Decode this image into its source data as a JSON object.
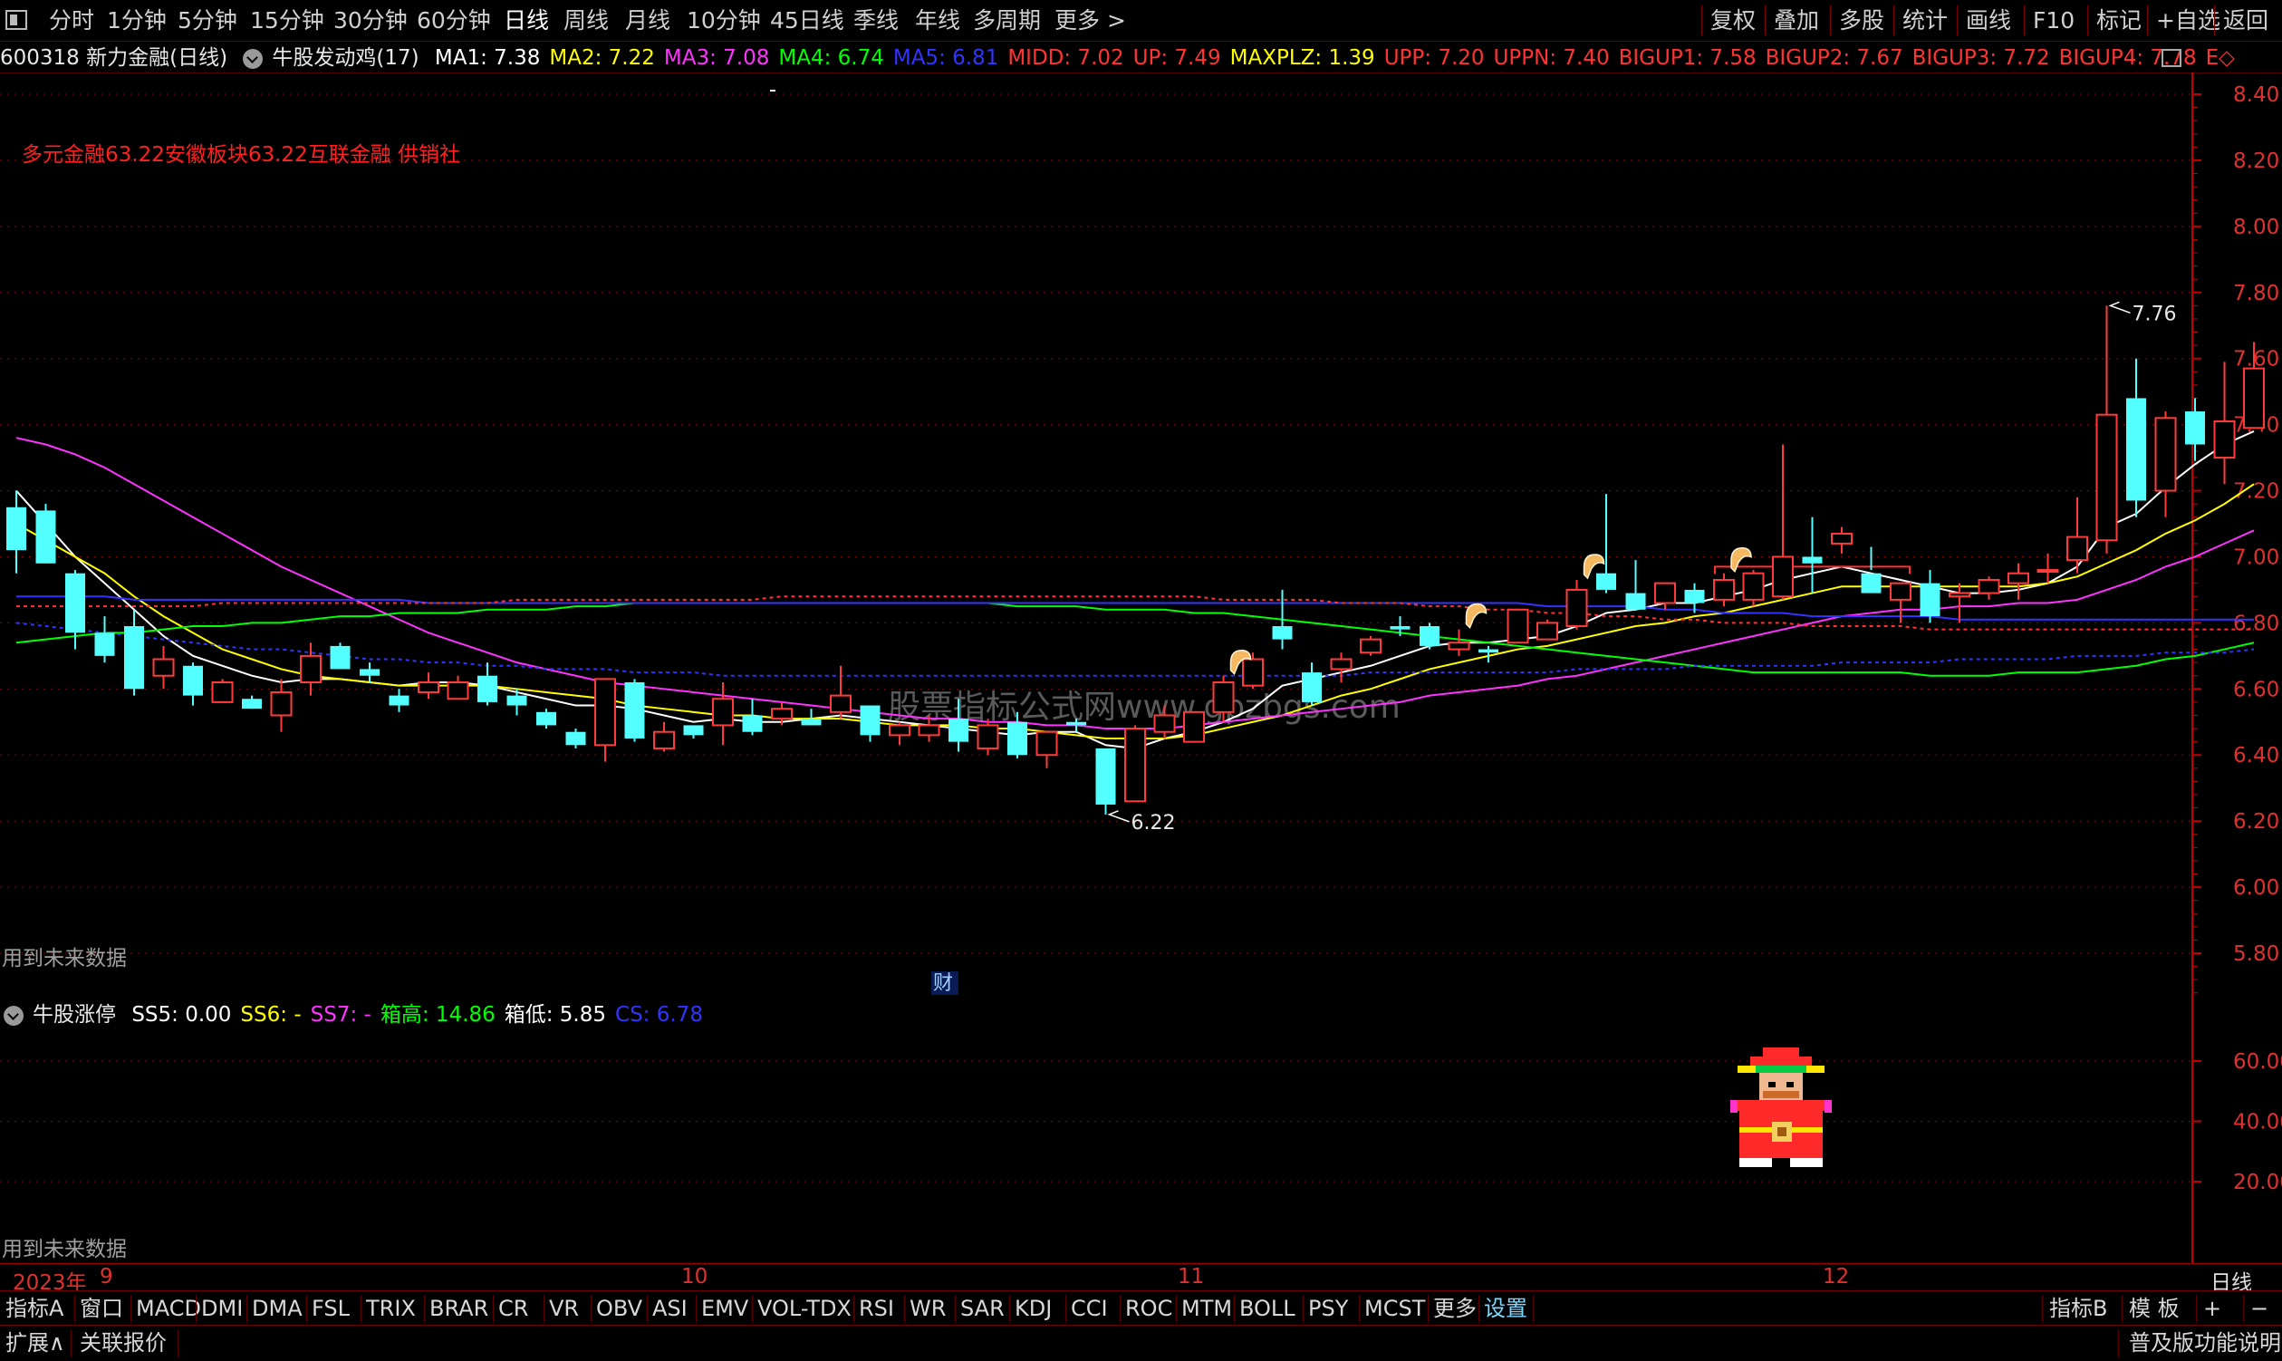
{
  "toolbar": {
    "periods": [
      "分时",
      "1分钟",
      "5分钟",
      "15分钟",
      "30分钟",
      "60分钟",
      "日线",
      "周线",
      "月线",
      "10分钟",
      "45日线",
      "季线",
      "年线",
      "多周期",
      "更多 >"
    ],
    "active_period": "日线",
    "right_buttons": [
      "复权",
      "叠加",
      "多股",
      "统计",
      "画线",
      "F10",
      "标记",
      "+自选",
      "返回"
    ]
  },
  "info": {
    "stock": "600318 新力金融(日线)",
    "indicator": "牛股发动鸡(17)",
    "values": [
      {
        "text": "MA1: 7.38",
        "color": "#ffffff"
      },
      {
        "text": "MA2: 7.22",
        "color": "#ffff00"
      },
      {
        "text": "MA3: 7.08",
        "color": "#ff33ff"
      },
      {
        "text": "MA4: 6.74",
        "color": "#00ff00"
      },
      {
        "text": "MA5: 6.81",
        "color": "#3333ff"
      },
      {
        "text": "MIDD: 7.02",
        "color": "#ff3333"
      },
      {
        "text": "UP: 7.49",
        "color": "#ff3333"
      },
      {
        "text": "MAXPLZ: 1.39",
        "color": "#ffff00"
      },
      {
        "text": "UPP: 7.20",
        "color": "#ff3333"
      },
      {
        "text": "UPPN: 7.40",
        "color": "#ff3333"
      },
      {
        "text": "BIGUP1: 7.58",
        "color": "#ff3333"
      },
      {
        "text": "BIGUP2: 7.67",
        "color": "#ff3333"
      },
      {
        "text": "BIGUP3: 7.72",
        "color": "#ff3333"
      },
      {
        "text": "BIGUP4: 7.78",
        "color": "#ff3333"
      },
      {
        "text": "E◇",
        "color": "#ff3333"
      }
    ]
  },
  "main": {
    "sector_text": "多元金融63.22安徽板块63.22互联金融 供销社",
    "future_data_note": "用到未来数据",
    "watermark": "股票指标公式网www.gpzbgs.com",
    "cai_label": "财",
    "high_label": "7.76",
    "low_label": "6.22"
  },
  "sub": {
    "indicator": "牛股涨停",
    "values": [
      {
        "text": "SS5: 0.00",
        "color": "#ffffff"
      },
      {
        "text": "SS6: -",
        "color": "#ffff00"
      },
      {
        "text": "SS7: -",
        "color": "#ff33ff"
      },
      {
        "text": "箱高: 14.86",
        "color": "#00ff00"
      },
      {
        "text": "箱低: 5.85",
        "color": "#ffffff"
      },
      {
        "text": "CS: 6.78",
        "color": "#3333ff"
      }
    ],
    "future_data_note": "用到未来数据"
  },
  "dates": {
    "year": "2023年",
    "months": [
      "9",
      "10",
      "11",
      "12"
    ],
    "period": "日线"
  },
  "tabs": [
    "指标A",
    "窗口",
    "MACD",
    "DMI",
    "DMA",
    "FSL",
    "TRIX",
    "BRAR",
    "CR",
    "VR",
    "OBV",
    "ASI",
    "EMV",
    "VOL-TDX",
    "RSI",
    "WR",
    "SAR",
    "KDJ",
    "CCI",
    "ROC",
    "MTM",
    "BOLL",
    "PSY",
    "MCST",
    "更多",
    "设置"
  ],
  "tabs_right": [
    "指标B",
    "模 板",
    "+",
    "−"
  ],
  "status": {
    "left": [
      "扩展∧",
      "关联报价"
    ],
    "right": "普及版功能说明"
  },
  "colors": {
    "up": "#ff3a3a",
    "down": "#54ffff",
    "grid": "#8a0000",
    "axis_text": "#e03030"
  },
  "chart_data": {
    "type": "candlestick",
    "ylim": [
      5.7,
      8.5
    ],
    "yticks": [
      8.4,
      8.2,
      8.0,
      7.8,
      7.6,
      7.4,
      7.2,
      7.0,
      6.8,
      6.6,
      6.4,
      6.2,
      6.0,
      5.8
    ],
    "sub_yticks": [
      60.0,
      40.0,
      20.0
    ],
    "sub_ylim": [
      0,
      80
    ],
    "candles": [
      [
        7.15,
        7.2,
        6.95,
        7.02
      ],
      [
        7.14,
        7.16,
        6.98,
        6.98
      ],
      [
        6.95,
        6.96,
        6.72,
        6.77
      ],
      [
        6.77,
        6.82,
        6.68,
        6.7
      ],
      [
        6.79,
        6.84,
        6.58,
        6.6
      ],
      [
        6.64,
        6.73,
        6.6,
        6.69
      ],
      [
        6.67,
        6.68,
        6.55,
        6.58
      ],
      [
        6.56,
        6.63,
        6.56,
        6.62
      ],
      [
        6.57,
        6.58,
        6.54,
        6.54
      ],
      [
        6.52,
        6.63,
        6.47,
        6.59
      ],
      [
        6.62,
        6.74,
        6.58,
        6.7
      ],
      [
        6.73,
        6.74,
        6.66,
        6.66
      ],
      [
        6.66,
        6.68,
        6.62,
        6.64
      ],
      [
        6.58,
        6.6,
        6.53,
        6.55
      ],
      [
        6.59,
        6.65,
        6.57,
        6.62
      ],
      [
        6.57,
        6.64,
        6.57,
        6.62
      ],
      [
        6.64,
        6.68,
        6.55,
        6.56
      ],
      [
        6.58,
        6.6,
        6.52,
        6.55
      ],
      [
        6.53,
        6.54,
        6.48,
        6.49
      ],
      [
        6.47,
        6.48,
        6.42,
        6.43
      ],
      [
        6.43,
        6.63,
        6.38,
        6.63
      ],
      [
        6.62,
        6.63,
        6.44,
        6.45
      ],
      [
        6.42,
        6.5,
        6.41,
        6.47
      ],
      [
        6.49,
        6.49,
        6.45,
        6.46
      ],
      [
        6.49,
        6.62,
        6.43,
        6.57
      ],
      [
        6.52,
        6.57,
        6.46,
        6.47
      ],
      [
        6.51,
        6.56,
        6.49,
        6.54
      ],
      [
        6.51,
        6.54,
        6.49,
        6.49
      ],
      [
        6.53,
        6.67,
        6.51,
        6.58
      ],
      [
        6.55,
        6.55,
        6.44,
        6.46
      ],
      [
        6.46,
        6.5,
        6.43,
        6.49
      ],
      [
        6.46,
        6.52,
        6.44,
        6.49
      ],
      [
        6.51,
        6.57,
        6.41,
        6.44
      ],
      [
        6.42,
        6.51,
        6.4,
        6.49
      ],
      [
        6.5,
        6.53,
        6.39,
        6.4
      ],
      [
        6.4,
        6.47,
        6.36,
        6.47
      ],
      [
        6.5,
        6.51,
        6.47,
        6.49
      ],
      [
        6.42,
        6.42,
        6.22,
        6.25
      ],
      [
        6.26,
        6.49,
        6.26,
        6.48
      ],
      [
        6.47,
        6.55,
        6.45,
        6.52
      ],
      [
        6.44,
        6.52,
        6.44,
        6.53
      ],
      [
        6.53,
        6.64,
        6.5,
        6.62
      ],
      [
        6.61,
        6.71,
        6.6,
        6.69
      ],
      [
        6.79,
        6.9,
        6.72,
        6.75
      ],
      [
        6.65,
        6.68,
        6.55,
        6.56
      ],
      [
        6.66,
        6.71,
        6.62,
        6.69
      ],
      [
        6.71,
        6.76,
        6.7,
        6.75
      ],
      [
        6.79,
        6.82,
        6.76,
        6.78
      ],
      [
        6.79,
        6.8,
        6.72,
        6.73
      ],
      [
        6.72,
        6.78,
        6.7,
        6.74
      ],
      [
        6.72,
        6.73,
        6.68,
        6.71
      ],
      [
        6.74,
        6.84,
        6.74,
        6.84
      ],
      [
        6.75,
        6.81,
        6.76,
        6.8
      ],
      [
        6.79,
        6.93,
        6.78,
        6.9
      ],
      [
        6.95,
        7.19,
        6.89,
        6.9
      ],
      [
        6.89,
        6.99,
        6.86,
        6.84
      ],
      [
        6.86,
        6.92,
        6.84,
        6.92
      ],
      [
        6.9,
        6.92,
        6.83,
        6.86
      ],
      [
        6.87,
        6.95,
        6.85,
        6.93
      ],
      [
        6.87,
        6.96,
        6.85,
        6.95
      ],
      [
        6.88,
        7.34,
        6.87,
        7.0
      ],
      [
        7.0,
        7.12,
        6.89,
        6.98
      ],
      [
        7.04,
        7.09,
        7.01,
        7.07
      ],
      [
        6.95,
        7.03,
        6.96,
        6.89
      ],
      [
        6.87,
        6.92,
        6.8,
        6.92
      ],
      [
        6.92,
        6.96,
        6.8,
        6.82
      ],
      [
        6.88,
        6.92,
        6.8,
        6.89
      ],
      [
        6.89,
        6.94,
        6.87,
        6.93
      ],
      [
        6.92,
        6.98,
        6.87,
        6.95
      ],
      [
        6.96,
        7.01,
        6.92,
        6.96
      ],
      [
        6.99,
        7.18,
        6.95,
        7.06
      ],
      [
        7.05,
        7.76,
        7.01,
        7.43
      ],
      [
        7.48,
        7.6,
        7.12,
        7.17
      ],
      [
        7.2,
        7.44,
        7.12,
        7.42
      ],
      [
        7.44,
        7.48,
        7.29,
        7.34
      ],
      [
        7.3,
        7.59,
        7.22,
        7.41
      ],
      [
        7.39,
        7.65,
        7.39,
        7.57
      ]
    ],
    "ma": [
      {
        "name": "MA1",
        "color": "#ffffff",
        "values": [
          7.2,
          7.1,
          7.0,
          6.92,
          6.84,
          6.76,
          6.7,
          6.67,
          6.64,
          6.62,
          6.63,
          6.63,
          6.62,
          6.61,
          6.62,
          6.62,
          6.61,
          6.59,
          6.57,
          6.55,
          6.55,
          6.54,
          6.52,
          6.5,
          6.51,
          6.5,
          6.5,
          6.51,
          6.52,
          6.51,
          6.5,
          6.49,
          6.48,
          6.47,
          6.46,
          6.47,
          6.47,
          6.43,
          6.42,
          6.45,
          6.47,
          6.5,
          6.54,
          6.61,
          6.63,
          6.65,
          6.67,
          6.7,
          6.73,
          6.74,
          6.74,
          6.75,
          6.76,
          6.79,
          6.83,
          6.84,
          6.86,
          6.86,
          6.88,
          6.9,
          6.93,
          6.95,
          6.97,
          6.95,
          6.93,
          6.91,
          6.89,
          6.89,
          6.9,
          6.92,
          6.97,
          7.09,
          7.13,
          7.21,
          7.28,
          7.34,
          7.38
        ]
      },
      {
        "name": "MA2",
        "color": "#ffff00",
        "values": [
          7.1,
          7.05,
          7.0,
          6.95,
          6.88,
          6.82,
          6.77,
          6.72,
          6.69,
          6.66,
          6.64,
          6.63,
          6.62,
          6.61,
          6.61,
          6.61,
          6.61,
          6.6,
          6.59,
          6.58,
          6.57,
          6.55,
          6.54,
          6.53,
          6.52,
          6.52,
          6.51,
          6.51,
          6.51,
          6.5,
          6.49,
          6.49,
          6.49,
          6.48,
          6.48,
          6.47,
          6.46,
          6.45,
          6.45,
          6.45,
          6.46,
          6.48,
          6.5,
          6.52,
          6.55,
          6.58,
          6.6,
          6.63,
          6.66,
          6.68,
          6.7,
          6.72,
          6.73,
          6.75,
          6.77,
          6.79,
          6.8,
          6.82,
          6.83,
          6.85,
          6.87,
          6.89,
          6.91,
          6.91,
          6.91,
          6.91,
          6.91,
          6.91,
          6.91,
          6.92,
          6.94,
          6.98,
          7.02,
          7.07,
          7.11,
          7.16,
          7.22
        ]
      },
      {
        "name": "MA3",
        "color": "#ff33ff",
        "values": [
          7.36,
          7.34,
          7.31,
          7.27,
          7.22,
          7.17,
          7.12,
          7.07,
          7.02,
          6.97,
          6.93,
          6.89,
          6.85,
          6.81,
          6.77,
          6.74,
          6.71,
          6.68,
          6.66,
          6.64,
          6.62,
          6.61,
          6.6,
          6.59,
          6.58,
          6.57,
          6.56,
          6.55,
          6.54,
          6.53,
          6.52,
          6.51,
          6.51,
          6.5,
          6.5,
          6.49,
          6.49,
          6.48,
          6.48,
          6.48,
          6.49,
          6.5,
          6.51,
          6.52,
          6.53,
          6.54,
          6.55,
          6.56,
          6.58,
          6.59,
          6.6,
          6.61,
          6.63,
          6.64,
          6.66,
          6.68,
          6.7,
          6.72,
          6.74,
          6.76,
          6.78,
          6.8,
          6.82,
          6.83,
          6.84,
          6.84,
          6.85,
          6.85,
          6.86,
          6.86,
          6.87,
          6.9,
          6.93,
          6.97,
          7.0,
          7.04,
          7.08
        ]
      },
      {
        "name": "MA4",
        "color": "#00ff00",
        "values": [
          6.74,
          6.75,
          6.76,
          6.77,
          6.77,
          6.78,
          6.79,
          6.79,
          6.8,
          6.8,
          6.81,
          6.82,
          6.82,
          6.83,
          6.83,
          6.83,
          6.84,
          6.84,
          6.84,
          6.85,
          6.85,
          6.86,
          6.86,
          6.86,
          6.86,
          6.86,
          6.86,
          6.86,
          6.86,
          6.86,
          6.86,
          6.86,
          6.86,
          6.86,
          6.85,
          6.85,
          6.85,
          6.84,
          6.84,
          6.84,
          6.83,
          6.83,
          6.82,
          6.81,
          6.8,
          6.79,
          6.78,
          6.77,
          6.76,
          6.75,
          6.74,
          6.73,
          6.72,
          6.71,
          6.7,
          6.69,
          6.68,
          6.67,
          6.66,
          6.65,
          6.65,
          6.65,
          6.65,
          6.65,
          6.65,
          6.64,
          6.64,
          6.64,
          6.65,
          6.65,
          6.65,
          6.66,
          6.67,
          6.69,
          6.7,
          6.72,
          6.74
        ]
      },
      {
        "name": "MA5",
        "color": "#3333ff",
        "values": [
          6.88,
          6.88,
          6.88,
          6.88,
          6.87,
          6.87,
          6.87,
          6.87,
          6.87,
          6.87,
          6.87,
          6.87,
          6.87,
          6.87,
          6.86,
          6.86,
          6.86,
          6.86,
          6.86,
          6.86,
          6.86,
          6.86,
          6.86,
          6.86,
          6.86,
          6.86,
          6.86,
          6.86,
          6.86,
          6.86,
          6.86,
          6.86,
          6.86,
          6.86,
          6.86,
          6.86,
          6.86,
          6.86,
          6.86,
          6.86,
          6.86,
          6.86,
          6.86,
          6.86,
          6.86,
          6.86,
          6.86,
          6.86,
          6.86,
          6.86,
          6.86,
          6.86,
          6.85,
          6.85,
          6.85,
          6.85,
          6.84,
          6.84,
          6.83,
          6.83,
          6.83,
          6.82,
          6.82,
          6.82,
          6.82,
          6.82,
          6.81,
          6.81,
          6.81,
          6.81,
          6.81,
          6.81,
          6.81,
          6.81,
          6.81,
          6.81,
          6.81
        ]
      },
      {
        "name": "CS",
        "color": "#3333ff",
        "dashed": true,
        "values": [
          6.8,
          6.79,
          6.78,
          6.77,
          6.76,
          6.75,
          6.74,
          6.73,
          6.72,
          6.72,
          6.71,
          6.7,
          6.69,
          6.69,
          6.68,
          6.68,
          6.67,
          6.67,
          6.66,
          6.66,
          6.66,
          6.65,
          6.65,
          6.65,
          6.64,
          6.64,
          6.64,
          6.64,
          6.64,
          6.64,
          6.64,
          6.64,
          6.64,
          6.64,
          6.64,
          6.64,
          6.64,
          6.64,
          6.64,
          6.64,
          6.64,
          6.64,
          6.64,
          6.64,
          6.64,
          6.64,
          6.65,
          6.65,
          6.65,
          6.65,
          6.65,
          6.65,
          6.65,
          6.66,
          6.66,
          6.66,
          6.66,
          6.67,
          6.67,
          6.67,
          6.67,
          6.67,
          6.68,
          6.68,
          6.68,
          6.68,
          6.69,
          6.69,
          6.69,
          6.69,
          6.7,
          6.7,
          6.7,
          6.71,
          6.71,
          6.71,
          6.72
        ]
      },
      {
        "name": "MIDD",
        "color": "#ff3333",
        "dashed": true,
        "values": [
          6.85,
          6.85,
          6.85,
          6.85,
          6.85,
          6.85,
          6.85,
          6.86,
          6.86,
          6.86,
          6.86,
          6.86,
          6.86,
          6.86,
          6.86,
          6.86,
          6.86,
          6.87,
          6.87,
          6.87,
          6.87,
          6.87,
          6.87,
          6.87,
          6.87,
          6.87,
          6.88,
          6.88,
          6.88,
          6.88,
          6.88,
          6.88,
          6.88,
          6.88,
          6.88,
          6.88,
          6.88,
          6.88,
          6.88,
          6.88,
          6.88,
          6.87,
          6.87,
          6.87,
          6.87,
          6.86,
          6.86,
          6.86,
          6.85,
          6.85,
          6.84,
          6.84,
          6.83,
          6.83,
          6.82,
          6.82,
          6.81,
          6.81,
          6.8,
          6.8,
          6.8,
          6.79,
          6.79,
          6.79,
          6.79,
          6.78,
          6.78,
          6.78,
          6.78,
          6.78,
          6.78,
          6.78,
          6.78,
          6.78,
          6.78,
          6.78,
          6.78
        ]
      }
    ],
    "markers": [
      41,
      49,
      53,
      58
    ],
    "box": {
      "from": 58,
      "to": 64,
      "value": 6.97
    },
    "high_index": 71,
    "low_index": 37
  }
}
